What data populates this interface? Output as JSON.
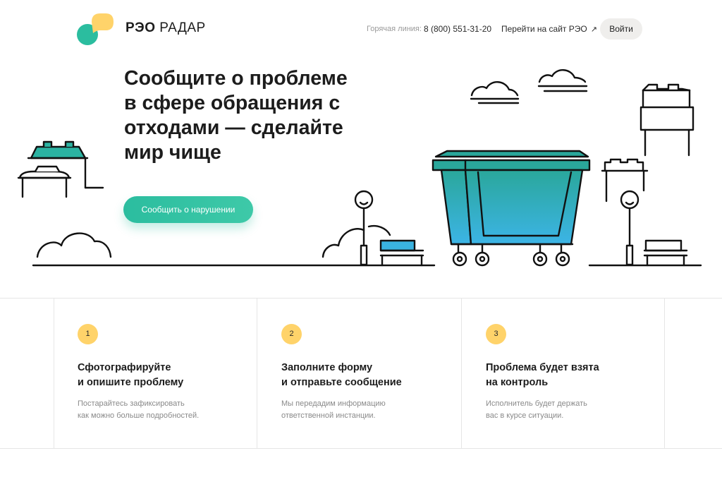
{
  "header": {
    "brand_bold": "РЭО",
    "brand_light": "РАДАР",
    "hotline_label": "Горячая линия:",
    "phone": "8 (800) 551-31-20",
    "site_link": "Перейти на сайт РЭО",
    "site_link_icon": "arrow-up-right-icon",
    "login_label": "Войти"
  },
  "hero": {
    "title": "Сообщите о проблеме\n в сфере обращения с\nотходами — сделайте\nмир чище",
    "cta_label": "Сообщить о нарушении"
  },
  "steps": [
    {
      "number": "1",
      "title": "Сфотографируйте\nи опишите проблему",
      "text": "Постарайтесь зафиксировать\nкак можно больше подробностей."
    },
    {
      "number": "2",
      "title": "Заполните форму\nи отправьте сообщение",
      "text": "Мы передадим информацию\nответственной инстанции."
    },
    {
      "number": "3",
      "title": "Проблема будет взята\nна контроль",
      "text": "Исполнитель будет держать\nвас в курсе ситуации."
    }
  ],
  "colors": {
    "accent_green": "#2bbd9f",
    "accent_yellow": "#ffd36a",
    "container_teal": "#2fb6b0",
    "container_blue": "#3ab3e0"
  }
}
